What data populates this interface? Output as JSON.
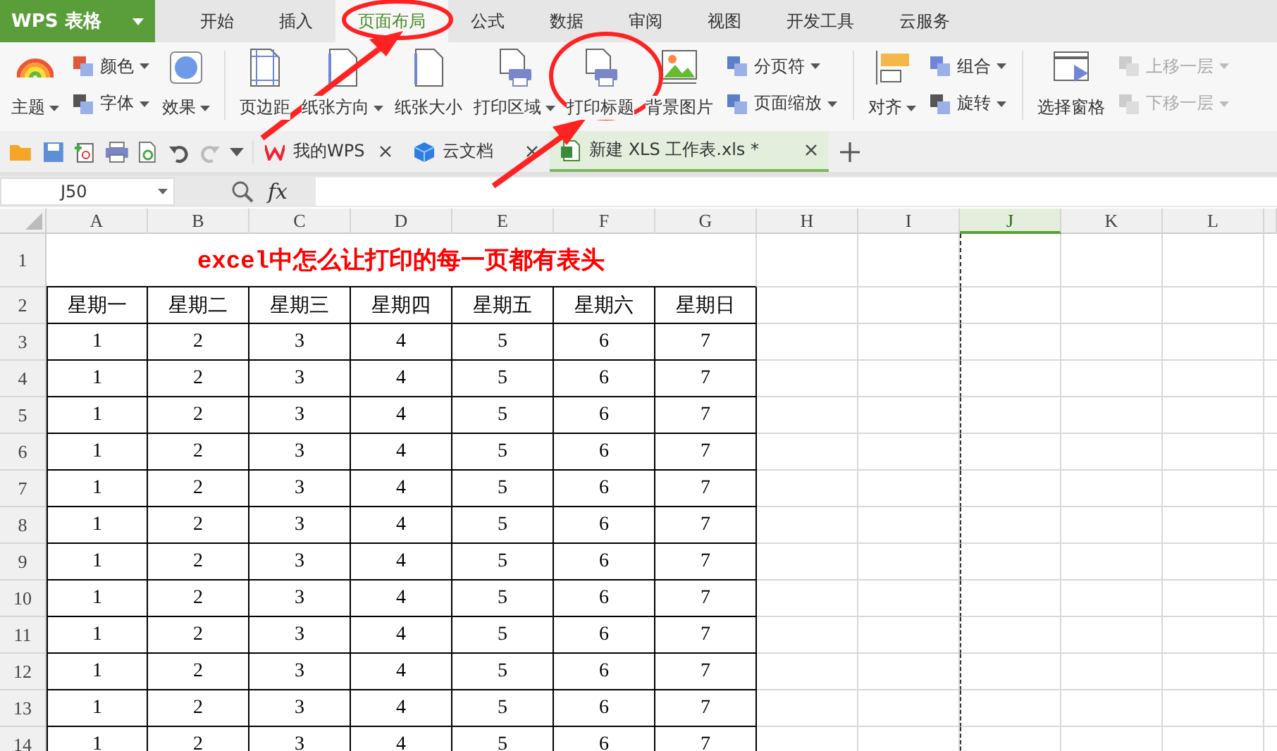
{
  "app": {
    "name": "WPS 表格"
  },
  "menu_tabs": [
    {
      "label": "开始",
      "selected": false
    },
    {
      "label": "插入",
      "selected": false
    },
    {
      "label": "页面布局",
      "selected": true
    },
    {
      "label": "公式",
      "selected": false
    },
    {
      "label": "数据",
      "selected": false
    },
    {
      "label": "审阅",
      "selected": false
    },
    {
      "label": "视图",
      "selected": false
    },
    {
      "label": "开发工具",
      "selected": false
    },
    {
      "label": "云服务",
      "selected": false
    }
  ],
  "ribbon": [
    {
      "kind": "big",
      "label": "主题",
      "dropdown": true
    },
    {
      "kind": "stack",
      "items": [
        {
          "label": "颜色",
          "dropdown": true,
          "disabled": false
        },
        {
          "label": "字体",
          "dropdown": true,
          "disabled": false
        }
      ]
    },
    {
      "kind": "big",
      "label": "效果",
      "dropdown": true
    },
    {
      "kind": "separator"
    },
    {
      "kind": "big",
      "label": "页边距",
      "dropdown": false
    },
    {
      "kind": "big",
      "label": "纸张方向",
      "dropdown": true
    },
    {
      "kind": "big",
      "label": "纸张大小",
      "dropdown": false
    },
    {
      "kind": "big",
      "label": "打印区域",
      "dropdown": true
    },
    {
      "kind": "big",
      "label": "打印标题",
      "dropdown": false
    },
    {
      "kind": "big",
      "label": "背景图片",
      "dropdown": false
    },
    {
      "kind": "stack",
      "items": [
        {
          "label": "分页符",
          "dropdown": true,
          "disabled": false
        },
        {
          "label": "页面缩放",
          "dropdown": true,
          "disabled": false
        }
      ]
    },
    {
      "kind": "separator"
    },
    {
      "kind": "big",
      "label": "对齐",
      "dropdown": true
    },
    {
      "kind": "stack",
      "items": [
        {
          "label": "组合",
          "dropdown": true,
          "disabled": false
        },
        {
          "label": "旋转",
          "dropdown": true,
          "disabled": false
        }
      ]
    },
    {
      "kind": "separator"
    },
    {
      "kind": "big",
      "label": "选择窗格",
      "dropdown": false
    },
    {
      "kind": "stack",
      "items": [
        {
          "label": "上移一层",
          "dropdown": true,
          "disabled": true
        },
        {
          "label": "下移一层",
          "dropdown": true,
          "disabled": true
        }
      ]
    }
  ],
  "doc_tabs": [
    {
      "label": "我的WPS",
      "selected": false
    },
    {
      "label": "云文档",
      "selected": false
    },
    {
      "label": "新建 XLS 工作表.xls *",
      "selected": true
    }
  ],
  "formula_bar": {
    "name_box": "J50",
    "fx": "fx"
  },
  "columns": [
    {
      "label": "A",
      "selected": false
    },
    {
      "label": "B",
      "selected": false
    },
    {
      "label": "C",
      "selected": false
    },
    {
      "label": "D",
      "selected": false
    },
    {
      "label": "E",
      "selected": false
    },
    {
      "label": "F",
      "selected": false
    },
    {
      "label": "G",
      "selected": false
    },
    {
      "label": "H",
      "selected": false
    },
    {
      "label": "I",
      "selected": false
    },
    {
      "label": "J",
      "selected": true
    },
    {
      "label": "K",
      "selected": false
    },
    {
      "label": "L",
      "selected": false
    }
  ],
  "rows": [
    {
      "kind": "title",
      "header": "1",
      "text": "excel中怎么让打印的每一页都有表头"
    },
    {
      "kind": "data",
      "header": "2",
      "cells": [
        "星期一",
        "星期二",
        "星期三",
        "星期四",
        "星期五",
        "星期六",
        "星期日"
      ]
    },
    {
      "kind": "data",
      "header": "3",
      "cells": [
        "1",
        "2",
        "3",
        "4",
        "5",
        "6",
        "7"
      ]
    },
    {
      "kind": "data",
      "header": "4",
      "cells": [
        "1",
        "2",
        "3",
        "4",
        "5",
        "6",
        "7"
      ]
    },
    {
      "kind": "data",
      "header": "5",
      "cells": [
        "1",
        "2",
        "3",
        "4",
        "5",
        "6",
        "7"
      ]
    },
    {
      "kind": "data",
      "header": "6",
      "cells": [
        "1",
        "2",
        "3",
        "4",
        "5",
        "6",
        "7"
      ]
    },
    {
      "kind": "data",
      "header": "7",
      "cells": [
        "1",
        "2",
        "3",
        "4",
        "5",
        "6",
        "7"
      ]
    },
    {
      "kind": "data",
      "header": "8",
      "cells": [
        "1",
        "2",
        "3",
        "4",
        "5",
        "6",
        "7"
      ]
    },
    {
      "kind": "data",
      "header": "9",
      "cells": [
        "1",
        "2",
        "3",
        "4",
        "5",
        "6",
        "7"
      ]
    },
    {
      "kind": "data",
      "header": "10",
      "cells": [
        "1",
        "2",
        "3",
        "4",
        "5",
        "6",
        "7"
      ]
    },
    {
      "kind": "data",
      "header": "11",
      "cells": [
        "1",
        "2",
        "3",
        "4",
        "5",
        "6",
        "7"
      ]
    },
    {
      "kind": "data",
      "header": "12",
      "cells": [
        "1",
        "2",
        "3",
        "4",
        "5",
        "6",
        "7"
      ]
    },
    {
      "kind": "data",
      "header": "13",
      "cells": [
        "1",
        "2",
        "3",
        "4",
        "5",
        "6",
        "7"
      ]
    },
    {
      "kind": "data",
      "header": "14",
      "cells": [
        "1",
        "2",
        "3",
        "4",
        "5",
        "6",
        "7"
      ]
    }
  ]
}
